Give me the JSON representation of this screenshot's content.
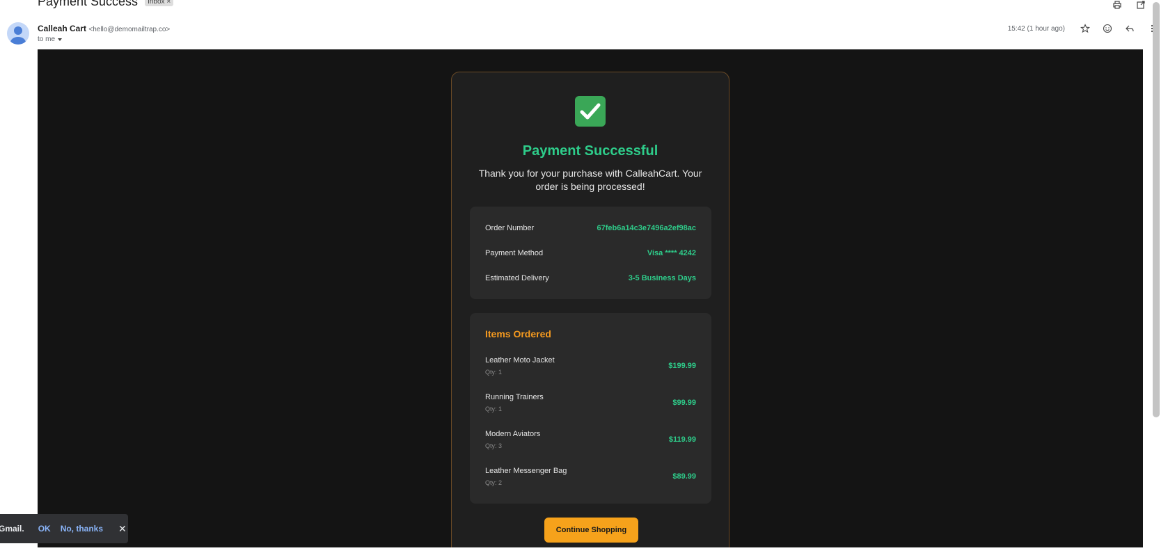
{
  "header": {
    "subject": "Payment Success",
    "chip_label": "Inbox",
    "chip_close": "×"
  },
  "message": {
    "sender_name": "Calleah Cart",
    "sender_address": "<hello@demomailtrap.co>",
    "to_label": "to me",
    "time": "15:42 (1 hour ago)"
  },
  "email": {
    "title": "Payment Successful",
    "lead": "Thank you for your purchase with CalleahCart. Your order is being processed!",
    "info": [
      {
        "label": "Order Number",
        "value": "67feb6a14c3e7496a2ef98ac"
      },
      {
        "label": "Payment Method",
        "value": "Visa **** 4242"
      },
      {
        "label": "Estimated Delivery",
        "value": "3-5 Business Days"
      }
    ],
    "items_title": "Items Ordered",
    "items": [
      {
        "name": "Leather Moto Jacket",
        "qty": "Qty: 1",
        "price": "$199.99"
      },
      {
        "name": "Running Trainers",
        "qty": "Qty: 1",
        "price": "$99.99"
      },
      {
        "name": "Modern Aviators",
        "qty": "Qty: 3",
        "price": "$119.99"
      },
      {
        "name": "Leather Messenger Bag",
        "qty": "Qty: 2",
        "price": "$89.99"
      }
    ],
    "cta": "Continue Shopping"
  },
  "toast": {
    "text": "Gmail.",
    "ok": "OK",
    "no": "No, thanks",
    "close": "✕"
  },
  "colors": {
    "accent_green": "#2ecc8a",
    "accent_orange": "#f59a1f",
    "email_bg": "#141414",
    "card_bg": "#1f1f1f"
  }
}
